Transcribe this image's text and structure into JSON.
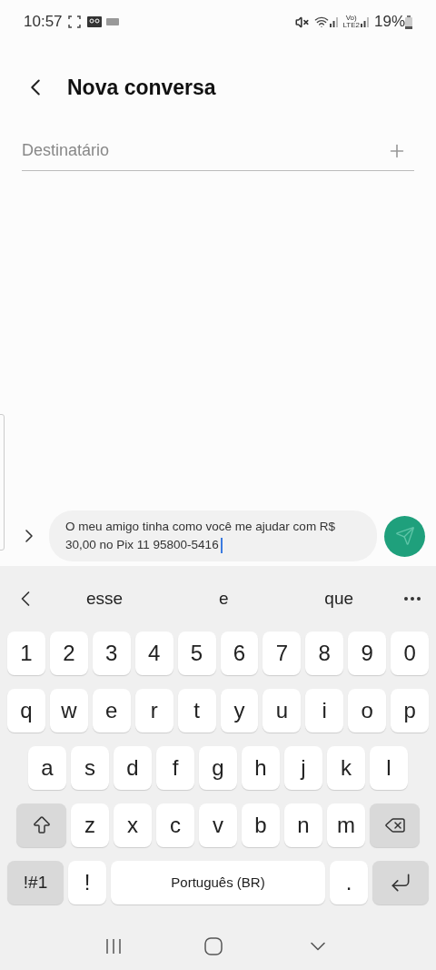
{
  "status_bar": {
    "time": "10:57",
    "network_top": "Vo)",
    "network_bottom": "LTE2",
    "battery": "19%"
  },
  "header": {
    "title": "Nova conversa"
  },
  "recipient": {
    "placeholder": "Destinatário"
  },
  "composer": {
    "value": "O meu amigo tinha como você me ajudar com R$ 30,00 no Pix 11 95800-5416"
  },
  "suggestions": [
    "esse",
    "e",
    "que"
  ],
  "keyboard": {
    "rows": [
      {
        "keys": [
          {
            "kind": "char",
            "label": "1"
          },
          {
            "kind": "char",
            "label": "2"
          },
          {
            "kind": "char",
            "label": "3"
          },
          {
            "kind": "char",
            "label": "4"
          },
          {
            "kind": "char",
            "label": "5"
          },
          {
            "kind": "char",
            "label": "6"
          },
          {
            "kind": "char",
            "label": "7"
          },
          {
            "kind": "char",
            "label": "8"
          },
          {
            "kind": "char",
            "label": "9"
          },
          {
            "kind": "char",
            "label": "0"
          }
        ]
      },
      {
        "keys": [
          {
            "kind": "char",
            "label": "q"
          },
          {
            "kind": "char",
            "label": "w"
          },
          {
            "kind": "char",
            "label": "e"
          },
          {
            "kind": "char",
            "label": "r"
          },
          {
            "kind": "char",
            "label": "t"
          },
          {
            "kind": "char",
            "label": "y"
          },
          {
            "kind": "char",
            "label": "u"
          },
          {
            "kind": "char",
            "label": "i"
          },
          {
            "kind": "char",
            "label": "o"
          },
          {
            "kind": "char",
            "label": "p"
          }
        ]
      },
      {
        "keys": [
          {
            "kind": "char",
            "label": "a"
          },
          {
            "kind": "char",
            "label": "s"
          },
          {
            "kind": "char",
            "label": "d"
          },
          {
            "kind": "char",
            "label": "f"
          },
          {
            "kind": "char",
            "label": "g"
          },
          {
            "kind": "char",
            "label": "h"
          },
          {
            "kind": "char",
            "label": "j"
          },
          {
            "kind": "char",
            "label": "k"
          },
          {
            "kind": "char",
            "label": "l"
          }
        ]
      },
      {
        "keys": [
          {
            "kind": "shift"
          },
          {
            "kind": "char",
            "label": "z"
          },
          {
            "kind": "char",
            "label": "x"
          },
          {
            "kind": "char",
            "label": "c"
          },
          {
            "kind": "char",
            "label": "v"
          },
          {
            "kind": "char",
            "label": "b"
          },
          {
            "kind": "char",
            "label": "n"
          },
          {
            "kind": "char",
            "label": "m"
          },
          {
            "kind": "backspace"
          }
        ]
      },
      {
        "keys": [
          {
            "kind": "symbols",
            "label": "!#1"
          },
          {
            "kind": "char",
            "label": "!"
          },
          {
            "kind": "space",
            "label": "Português (BR)"
          },
          {
            "kind": "char",
            "label": "."
          },
          {
            "kind": "enter"
          }
        ]
      }
    ]
  }
}
